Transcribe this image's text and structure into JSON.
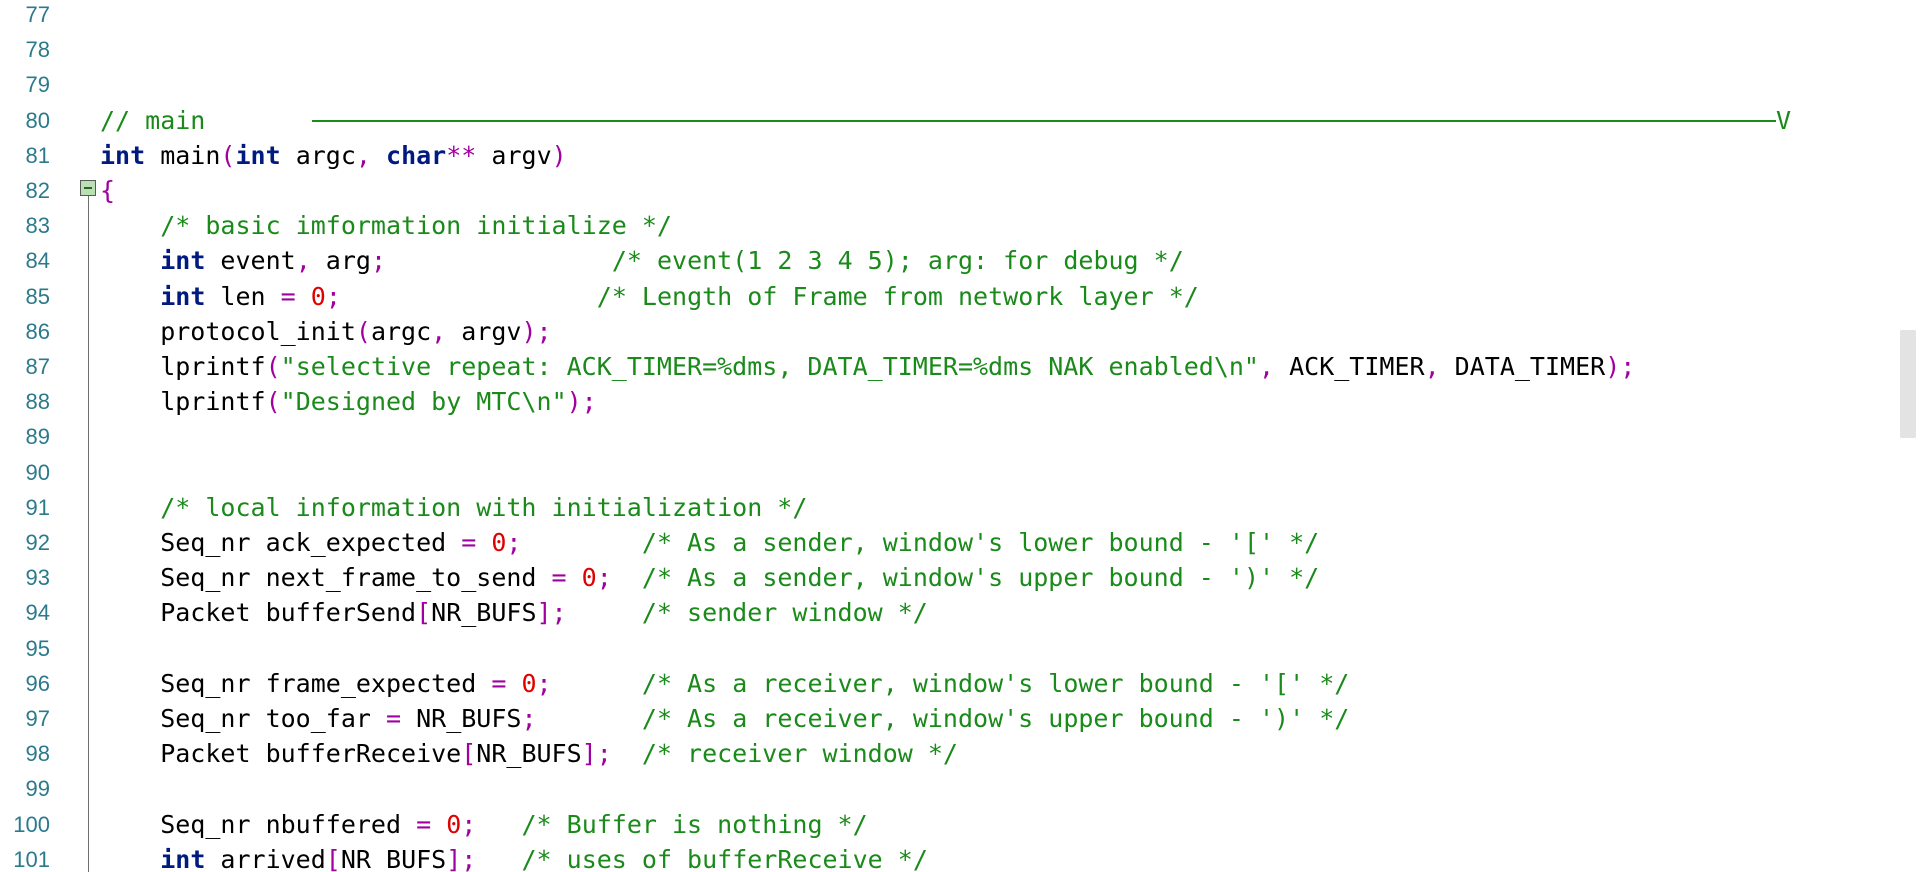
{
  "editor": {
    "lines": [
      {
        "n": "77",
        "tokens": []
      },
      {
        "n": "78",
        "tokens": []
      },
      {
        "n": "79",
        "tokens": []
      },
      {
        "n": "80",
        "tokens": [
          {
            "t": "// main",
            "c": "cm"
          }
        ]
      },
      {
        "n": "81",
        "tokens": [
          {
            "t": "int",
            "c": "kw"
          },
          {
            "t": " main",
            "c": "id"
          },
          {
            "t": "(",
            "c": "punc"
          },
          {
            "t": "int",
            "c": "kw"
          },
          {
            "t": " argc",
            "c": "id"
          },
          {
            "t": ",",
            "c": "punc"
          },
          {
            "t": " ",
            "c": "id"
          },
          {
            "t": "char",
            "c": "kw"
          },
          {
            "t": "**",
            "c": "punc"
          },
          {
            "t": " argv",
            "c": "id"
          },
          {
            "t": ")",
            "c": "punc"
          }
        ]
      },
      {
        "n": "82",
        "tokens": [
          {
            "t": "{",
            "c": "punc"
          }
        ]
      },
      {
        "n": "83",
        "tokens": [
          {
            "t": "    /* basic imformation initialize */",
            "c": "cm"
          }
        ]
      },
      {
        "n": "84",
        "tokens": [
          {
            "t": "    ",
            "c": "id"
          },
          {
            "t": "int",
            "c": "kw"
          },
          {
            "t": " event",
            "c": "id"
          },
          {
            "t": ",",
            "c": "punc"
          },
          {
            "t": " arg",
            "c": "id"
          },
          {
            "t": ";",
            "c": "punc"
          },
          {
            "t": "               ",
            "c": "id"
          },
          {
            "t": "/* event(1 2 3 4 5); arg: for debug */",
            "c": "cm"
          }
        ]
      },
      {
        "n": "85",
        "tokens": [
          {
            "t": "    ",
            "c": "id"
          },
          {
            "t": "int",
            "c": "kw"
          },
          {
            "t": " len ",
            "c": "id"
          },
          {
            "t": "=",
            "c": "punc"
          },
          {
            "t": " ",
            "c": "id"
          },
          {
            "t": "0",
            "c": "num"
          },
          {
            "t": ";",
            "c": "punc"
          },
          {
            "t": "                 ",
            "c": "id"
          },
          {
            "t": "/* Length of Frame from network layer */",
            "c": "cm"
          }
        ]
      },
      {
        "n": "86",
        "tokens": [
          {
            "t": "    protocol_init",
            "c": "id"
          },
          {
            "t": "(",
            "c": "punc"
          },
          {
            "t": "argc",
            "c": "id"
          },
          {
            "t": ",",
            "c": "punc"
          },
          {
            "t": " argv",
            "c": "id"
          },
          {
            "t": ");",
            "c": "punc"
          }
        ]
      },
      {
        "n": "87",
        "tokens": [
          {
            "t": "    lprintf",
            "c": "id"
          },
          {
            "t": "(",
            "c": "punc"
          },
          {
            "t": "\"selective repeat: ACK_TIMER=%dms, DATA_TIMER=%dms NAK enabled\\n\"",
            "c": "str"
          },
          {
            "t": ",",
            "c": "punc"
          },
          {
            "t": " ACK_TIMER",
            "c": "id"
          },
          {
            "t": ",",
            "c": "punc"
          },
          {
            "t": " DATA_TIMER",
            "c": "id"
          },
          {
            "t": ");",
            "c": "punc"
          }
        ]
      },
      {
        "n": "88",
        "tokens": [
          {
            "t": "    lprintf",
            "c": "id"
          },
          {
            "t": "(",
            "c": "punc"
          },
          {
            "t": "\"Designed by MTC\\n\"",
            "c": "str"
          },
          {
            "t": ");",
            "c": "punc"
          }
        ]
      },
      {
        "n": "89",
        "tokens": []
      },
      {
        "n": "90",
        "tokens": []
      },
      {
        "n": "91",
        "tokens": [
          {
            "t": "    /* local information with initialization */",
            "c": "cm"
          }
        ]
      },
      {
        "n": "92",
        "tokens": [
          {
            "t": "    Seq_nr ack_expected ",
            "c": "id"
          },
          {
            "t": "=",
            "c": "punc"
          },
          {
            "t": " ",
            "c": "id"
          },
          {
            "t": "0",
            "c": "num"
          },
          {
            "t": ";",
            "c": "punc"
          },
          {
            "t": "        ",
            "c": "id"
          },
          {
            "t": "/* As a sender, window's lower bound - '[' */",
            "c": "cm"
          }
        ]
      },
      {
        "n": "93",
        "tokens": [
          {
            "t": "    Seq_nr next_frame_to_send ",
            "c": "id"
          },
          {
            "t": "=",
            "c": "punc"
          },
          {
            "t": " ",
            "c": "id"
          },
          {
            "t": "0",
            "c": "num"
          },
          {
            "t": ";",
            "c": "punc"
          },
          {
            "t": "  ",
            "c": "id"
          },
          {
            "t": "/* As a sender, window's upper bound - ')' */",
            "c": "cm"
          }
        ]
      },
      {
        "n": "94",
        "tokens": [
          {
            "t": "    Packet bufferSend",
            "c": "id"
          },
          {
            "t": "[",
            "c": "punc"
          },
          {
            "t": "NR_BUFS",
            "c": "id"
          },
          {
            "t": "];",
            "c": "punc"
          },
          {
            "t": "     ",
            "c": "id"
          },
          {
            "t": "/* sender window */",
            "c": "cm"
          }
        ]
      },
      {
        "n": "95",
        "tokens": []
      },
      {
        "n": "96",
        "tokens": [
          {
            "t": "    Seq_nr frame_expected ",
            "c": "id"
          },
          {
            "t": "=",
            "c": "punc"
          },
          {
            "t": " ",
            "c": "id"
          },
          {
            "t": "0",
            "c": "num"
          },
          {
            "t": ";",
            "c": "punc"
          },
          {
            "t": "      ",
            "c": "id"
          },
          {
            "t": "/* As a receiver, window's lower bound - '[' */",
            "c": "cm"
          }
        ]
      },
      {
        "n": "97",
        "tokens": [
          {
            "t": "    Seq_nr too_far ",
            "c": "id"
          },
          {
            "t": "=",
            "c": "punc"
          },
          {
            "t": " NR_BUFS",
            "c": "id"
          },
          {
            "t": ";",
            "c": "punc"
          },
          {
            "t": "       ",
            "c": "id"
          },
          {
            "t": "/* As a receiver, window's upper bound - ')' */",
            "c": "cm"
          }
        ]
      },
      {
        "n": "98",
        "tokens": [
          {
            "t": "    Packet bufferReceive",
            "c": "id"
          },
          {
            "t": "[",
            "c": "punc"
          },
          {
            "t": "NR_BUFS",
            "c": "id"
          },
          {
            "t": "];",
            "c": "punc"
          },
          {
            "t": "  ",
            "c": "id"
          },
          {
            "t": "/* receiver window */",
            "c": "cm"
          }
        ]
      },
      {
        "n": "99",
        "tokens": []
      },
      {
        "n": "100",
        "tokens": [
          {
            "t": "    Seq_nr nbuffered ",
            "c": "id"
          },
          {
            "t": "=",
            "c": "punc"
          },
          {
            "t": " ",
            "c": "id"
          },
          {
            "t": "0",
            "c": "num"
          },
          {
            "t": ";",
            "c": "punc"
          },
          {
            "t": "   ",
            "c": "id"
          },
          {
            "t": "/* Buffer is nothing */",
            "c": "cm"
          }
        ]
      },
      {
        "n": "101",
        "tokens": [
          {
            "t": "    ",
            "c": "id"
          },
          {
            "t": "int",
            "c": "kw"
          },
          {
            "t": " arrived",
            "c": "id"
          },
          {
            "t": "[",
            "c": "punc"
          },
          {
            "t": "NR_BUFS",
            "c": "id"
          },
          {
            "t": "];",
            "c": "punc"
          },
          {
            "t": "   ",
            "c": "id"
          },
          {
            "t": "/* uses of bufferReceive */",
            "c": "cm"
          }
        ]
      }
    ],
    "separator_tail": "V",
    "fold_line": "82",
    "colors": {
      "keyword": "#001a80",
      "comment": "#1a8a1a",
      "string": "#1a8a1a",
      "number": "#e00000",
      "punctuation": "#a000a0",
      "line_number": "#2b7a8c"
    }
  }
}
